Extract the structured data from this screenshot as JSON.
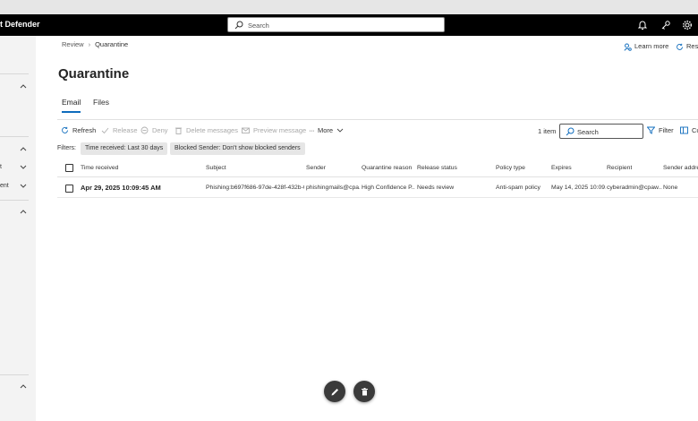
{
  "app": {
    "name": "t Defender"
  },
  "search": {
    "placeholder": "Search"
  },
  "left_nav": {
    "frag1": "t",
    "frag2": "ent"
  },
  "breadcrumb": {
    "root": "Review",
    "current": "Quarantine"
  },
  "header": {
    "learn_more": "Learn more",
    "reset": "Res"
  },
  "page": {
    "title": "Quarantine"
  },
  "tabs": [
    {
      "label": "Email",
      "active": true
    },
    {
      "label": "Files",
      "active": false
    }
  ],
  "toolbar": {
    "refresh": "Refresh",
    "release": "Release",
    "deny": "Deny",
    "delete_messages": "Delete messages",
    "preview_message": "Preview message",
    "more": "More",
    "item_count": "1 item",
    "search_placeholder": "Search",
    "filter": "Filter",
    "customize": "Cu"
  },
  "filters": {
    "label": "Filters:",
    "chips": [
      {
        "key": "Time received:",
        "value": "Last 30 days"
      },
      {
        "key": "Blocked Sender:",
        "value": "Don't show blocked senders"
      }
    ]
  },
  "table": {
    "columns": [
      "Time received",
      "Subject",
      "Sender",
      "Quarantine reason",
      "Release status",
      "Policy type",
      "Expires",
      "Recipient",
      "Sender address"
    ],
    "rows": [
      {
        "time_received": "Apr 29, 2025 10:09:45 AM",
        "subject": "Phishing:b697f686-97de-428f-432b-0...",
        "sender": "phishingmails@cpa...",
        "quarantine_reason": "High Confidence P...",
        "release_status": "Needs review",
        "policy_type": "Anti-spam policy",
        "expires": "May 14, 2025 10:09...",
        "recipient": "cyberadmin@cpaw...",
        "sender_address": "None"
      }
    ]
  },
  "colors": {
    "accent": "#0f6cbd",
    "topbar": "#000000",
    "nav_bg": "#f3f3f3",
    "fab": "#3b3b3b"
  },
  "icons": [
    "search-icon",
    "bell-icon",
    "key-icon",
    "gear-icon",
    "learn-more-icon",
    "reset-icon",
    "refresh-icon",
    "check-icon",
    "deny-icon",
    "trash-icon",
    "mail-icon",
    "ellipsis-icon",
    "chevron-down-icon",
    "filter-icon",
    "customize-icon",
    "pencil-icon"
  ]
}
